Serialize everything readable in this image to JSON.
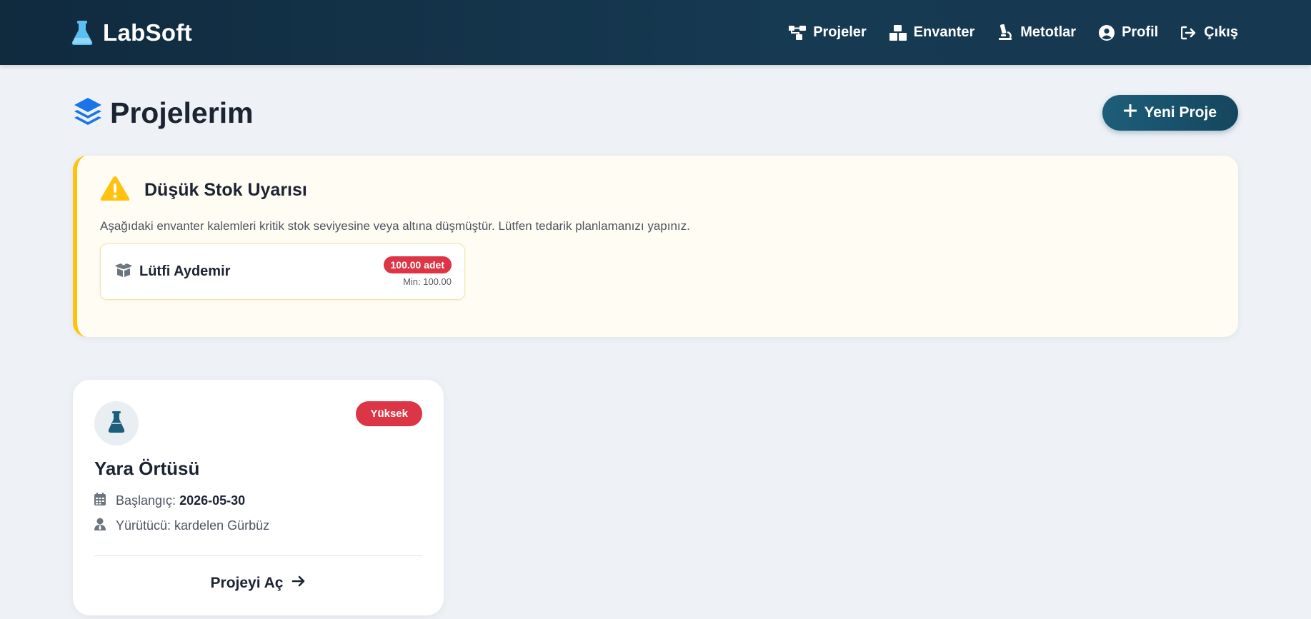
{
  "brand": {
    "name": "LabSoft",
    "icon": "flask-icon"
  },
  "nav": {
    "items": [
      {
        "label": "Projeler",
        "icon": "sitemap-icon"
      },
      {
        "label": "Envanter",
        "icon": "boxes-icon"
      },
      {
        "label": "Metotlar",
        "icon": "microscope-icon"
      },
      {
        "label": "Profil",
        "icon": "user-circle-icon"
      },
      {
        "label": "Çıkış",
        "icon": "sign-out-icon"
      }
    ]
  },
  "page": {
    "title": "Projelerim",
    "title_icon": "layer-group-icon",
    "new_button": "Yeni Proje"
  },
  "alert": {
    "title": "Düşük Stok Uyarısı",
    "description": "Aşağıdaki envanter kalemleri kritik stok seviyesine veya altına düşmüştür. Lütfen tedarik planlamanızı yapınız.",
    "items": [
      {
        "name": "Lütfi Aydemir",
        "quantity": "100.00 adet",
        "min": "Min: 100.00"
      }
    ]
  },
  "projects": [
    {
      "title": "Yara Örtüsü",
      "priority": "Yüksek",
      "start_label": "Başlangıç:",
      "start_date": "2026-05-30",
      "owner": "Yürütücü: kardelen Gürbüz",
      "open_label": "Projeyi Aç"
    }
  ],
  "colors": {
    "navbar": "#102a3e",
    "primary_button": "#1d5e7a",
    "warning": "#ffc20e",
    "danger": "#dc3545",
    "page_bg": "#eef2f7"
  }
}
